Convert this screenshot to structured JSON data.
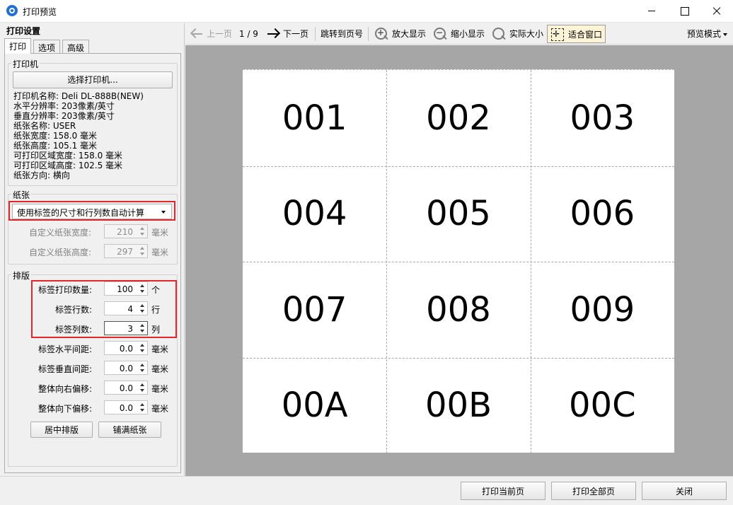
{
  "window": {
    "title": "打印预览"
  },
  "left_panel": {
    "title": "打印设置",
    "tabs": [
      {
        "label": "打印",
        "active": true
      },
      {
        "label": "选项",
        "active": false
      },
      {
        "label": "高级",
        "active": false
      }
    ],
    "printer": {
      "group_title": "打印机",
      "select_button": "选择打印机...",
      "info": [
        "打印机名称: Deli DL-888B(NEW)",
        "水平分辨率: 203像素/英寸",
        "垂直分辨率: 203像素/英寸",
        "纸张名称: USER",
        "纸张宽度: 158.0 毫米",
        "纸张高度: 105.1 毫米",
        "可打印区域宽度: 158.0 毫米",
        "可打印区域高度: 102.5 毫米",
        "纸张方向: 横向"
      ]
    },
    "paper": {
      "group_title": "纸张",
      "mode_select": "使用标签的尺寸和行列数自动计算",
      "custom_width": {
        "label": "自定义纸张宽度:",
        "value": "210",
        "unit": "毫米"
      },
      "custom_height": {
        "label": "自定义纸张高度:",
        "value": "297",
        "unit": "毫米"
      }
    },
    "layout": {
      "group_title": "排版",
      "fields": [
        {
          "label": "标签打印数量:",
          "value": "100",
          "unit": "个"
        },
        {
          "label": "标签行数:",
          "value": "4",
          "unit": "行"
        },
        {
          "label": "标签列数:",
          "value": "3",
          "unit": "列"
        },
        {
          "label": "标签水平间距:",
          "value": "0.0",
          "unit": "毫米"
        },
        {
          "label": "标签垂直间距:",
          "value": "0.0",
          "unit": "毫米"
        },
        {
          "label": "整体向右偏移:",
          "value": "0.0",
          "unit": "毫米"
        },
        {
          "label": "整体向下偏移:",
          "value": "0.0",
          "unit": "毫米"
        }
      ],
      "center_button": "居中排版",
      "fill_button": "铺满纸张"
    }
  },
  "toolbar": {
    "prev_page": "上一页",
    "page_indicator": "1 / 9",
    "next_page": "下一页",
    "goto_page": "跳转到页号",
    "zoom_in": "放大显示",
    "zoom_out": "缩小显示",
    "actual_size": "实际大小",
    "fit_window": "适合窗口",
    "preview_mode": "预览模式"
  },
  "preview": {
    "rows": 4,
    "columns": 3,
    "labels": [
      "001",
      "002",
      "003",
      "004",
      "005",
      "006",
      "007",
      "008",
      "009",
      "00A",
      "00B",
      "00C"
    ]
  },
  "bottom": {
    "print_current": "打印当前页",
    "print_all": "打印全部页",
    "close": "关闭"
  },
  "colors": {
    "highlight_border": "#e3262c",
    "active_tool_bg": "#fdf3d6",
    "canvas_bg": "#a6a6a6"
  }
}
